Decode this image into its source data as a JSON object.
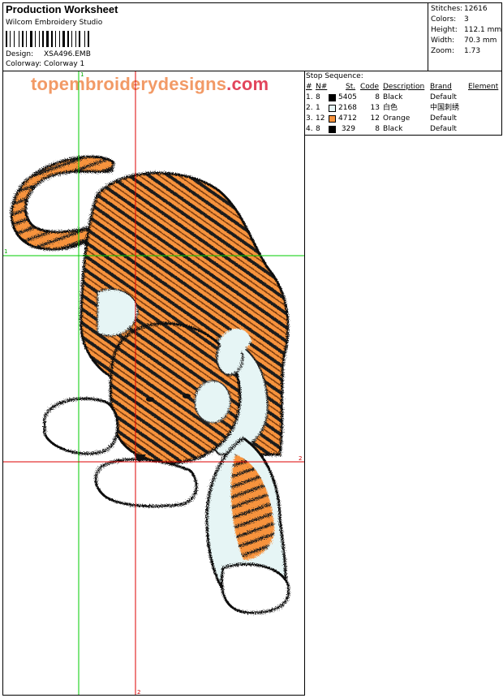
{
  "header": {
    "title": "Production Worksheet",
    "software": "Wilcom Embroidery Studio",
    "design_label": "Design:",
    "design_value": "XSA496.EMB",
    "colorway_label": "Colorway:",
    "colorway_value": "Colorway 1"
  },
  "stats": {
    "stitches_label": "Stitches:",
    "stitches_value": "12616",
    "colors_label": "Colors:",
    "colors_value": "3",
    "height_label": "Height:",
    "height_value": "112.1 mm",
    "width_label": "Width:",
    "width_value": "70.3 mm",
    "zoom_label": "Zoom:",
    "zoom_value": "1.73"
  },
  "watermark": {
    "main": "topembroiderydesigns",
    "suffix": ".com"
  },
  "markers": {
    "h1": "1",
    "h2": "2",
    "v1": "1",
    "v2": "2"
  },
  "stop_sequence": {
    "title": "Stop Sequence:",
    "columns": [
      "#",
      "N#",
      "St.",
      "Code",
      "Description",
      "Brand",
      "Element"
    ],
    "rows": [
      {
        "idx": "1.",
        "n": "8",
        "color": "#000000",
        "st": "5405",
        "code": "8",
        "desc": "Black",
        "brand": "Default"
      },
      {
        "idx": "2.",
        "n": "1",
        "color": "#e6f5f5",
        "st": "2168",
        "code": "13",
        "desc": "白色",
        "brand": "中国刺绣"
      },
      {
        "idx": "3.",
        "n": "12",
        "color": "#f7933c",
        "st": "4712",
        "code": "12",
        "desc": "Orange",
        "brand": "Default"
      },
      {
        "idx": "4.",
        "n": "8",
        "color": "#000000",
        "st": "329",
        "code": "8",
        "desc": "Black",
        "brand": "Default"
      }
    ]
  },
  "colors": {
    "orange": "#f7933c",
    "light": "#e6f5f5",
    "black": "#000000",
    "guide_green": "#00cc00",
    "guide_red": "#dd0000"
  }
}
